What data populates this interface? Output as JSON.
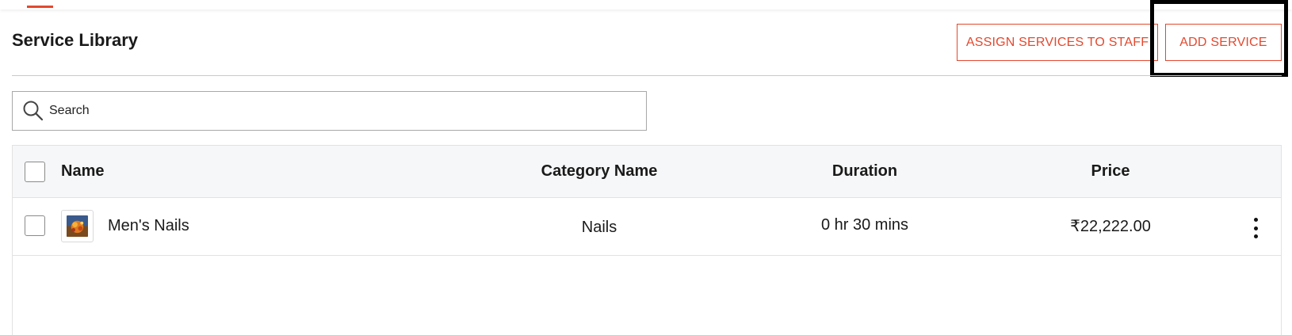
{
  "header": {
    "title": "Service Library",
    "assign_label": "ASSIGN SERVICES TO STAFF",
    "add_label": "ADD SERVICE"
  },
  "search": {
    "placeholder": "Search",
    "value": ""
  },
  "table": {
    "columns": {
      "name": "Name",
      "category": "Category Name",
      "duration": "Duration",
      "price": "Price"
    },
    "rows": [
      {
        "name": "Men's Nails",
        "category": "Nails",
        "duration": "0 hr 30 mins",
        "price": "₹22,222.00",
        "thumbnail": "service-thumbnail",
        "checked": false
      }
    ]
  },
  "icons": {
    "search": "search-icon",
    "row_menu": "more-vertical-icon"
  },
  "colors": {
    "accent": "#e2492f",
    "header_bg": "#f6f7f8",
    "border": "#e2e2e2",
    "highlight": "#000000"
  }
}
